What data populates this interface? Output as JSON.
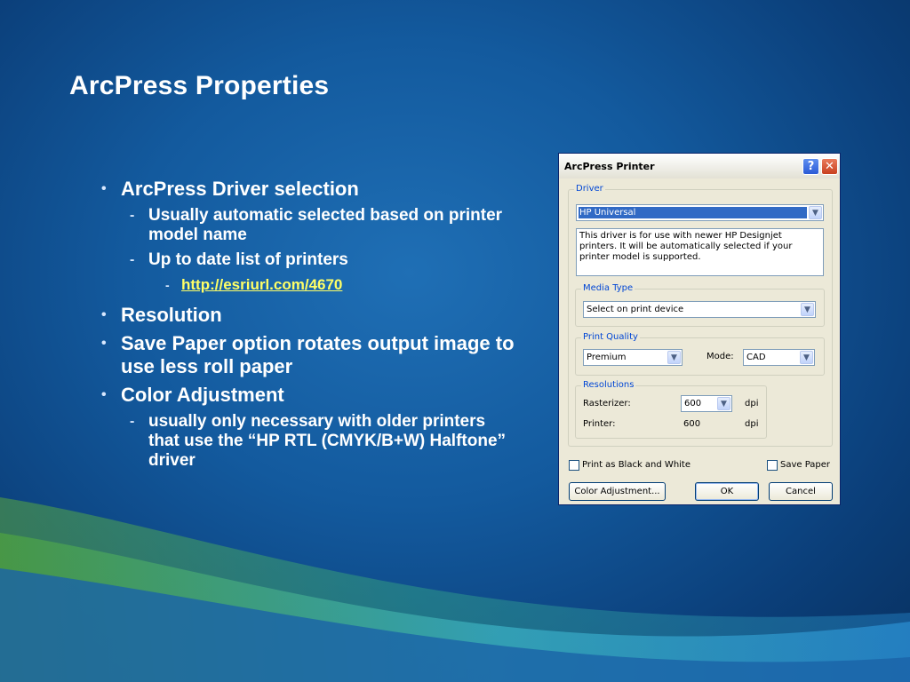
{
  "slide": {
    "title": "ArcPress Properties",
    "bullets": [
      {
        "text": "ArcPress Driver selection",
        "sub": [
          {
            "text": "Usually automatic selected based on printer model name"
          },
          {
            "text": "Up to date list of printers",
            "sub": [
              {
                "text": "http://esriurl.com/4670"
              }
            ]
          }
        ]
      },
      {
        "text": "Resolution"
      },
      {
        "text": "Save Paper option rotates output image to use less roll paper"
      },
      {
        "text": "Color Adjustment",
        "sub": [
          {
            "text": "usually only necessary with older printers that use the  “HP RTL (CMYK/B+W) Halftone” driver"
          }
        ]
      }
    ],
    "bullet_glyph": "•",
    "dash_glyph": "-"
  },
  "dialog": {
    "title": "ArcPress Printer",
    "help_glyph": "?",
    "close_glyph": "✕",
    "driver": {
      "legend": "Driver",
      "selected": "HP Universal",
      "description": "This driver is for use with newer HP Designjet printers. It will be automatically selected if your printer model is supported."
    },
    "media_type": {
      "legend": "Media Type",
      "selected": "Select on print device"
    },
    "print_quality": {
      "legend": "Print Quality",
      "selected": "Premium",
      "mode_label": "Mode:",
      "mode_selected": "CAD"
    },
    "resolutions": {
      "legend": "Resolutions",
      "rasterizer_label": "Rasterizer:",
      "rasterizer_value": "600",
      "rasterizer_unit": "dpi",
      "printer_label": "Printer:",
      "printer_value": "600",
      "printer_unit": "dpi"
    },
    "print_bw_label": "Print as Black and White",
    "save_paper_label": "Save Paper",
    "buttons": {
      "color_adjustment": "Color Adjustment...",
      "ok": "OK",
      "cancel": "Cancel"
    },
    "arrow_glyph": "▼"
  }
}
